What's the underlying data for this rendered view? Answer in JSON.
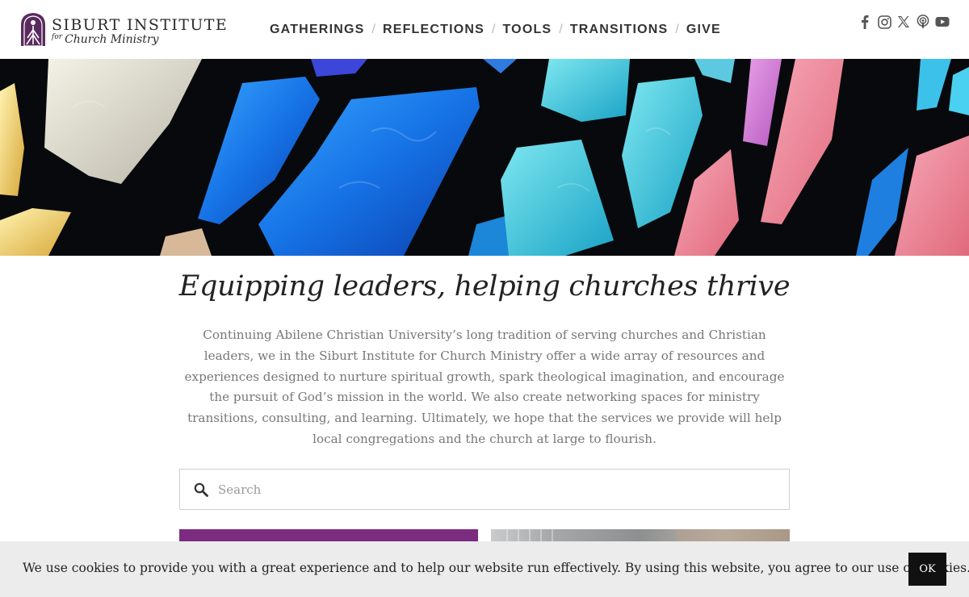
{
  "brand": {
    "name": "SIBURT INSTITUTE",
    "sub_for": "for",
    "sub_name": "Church Ministry",
    "color": "#5a2a5e"
  },
  "nav": {
    "items": [
      "GATHERINGS",
      "REFLECTIONS",
      "TOOLS",
      "TRANSITIONS",
      "GIVE"
    ],
    "separator": "/"
  },
  "social": {
    "icons": [
      "facebook-icon",
      "instagram-icon",
      "x-twitter-icon",
      "podcast-icon",
      "youtube-icon"
    ]
  },
  "hero": {
    "description_icon": "stained-glass-banner"
  },
  "main": {
    "tagline": "Equipping leaders, helping churches thrive",
    "intro": "Continuing Abilene Christian University’s long tradition of serving churches and Christian leaders, we in the Siburt Institute for Church Ministry offer a wide array of resources and experiences designed to nurture spiritual growth, spark theological imagination, and encourage the pursuit of God’s mission in the world. We also create networking spaces for ministry transitions, consulting, and learning. Ultimately, we hope that the services we provide will help local congregations and the church at large to flourish."
  },
  "search": {
    "placeholder": "Search",
    "value": ""
  },
  "cards": {
    "accent_color": "#7b2c80"
  },
  "cookie": {
    "text": "We use cookies to provide you with a great experience and to help our website run effectively. By using this website, you agree to our use of cookies.",
    "ok_label": "OK"
  }
}
